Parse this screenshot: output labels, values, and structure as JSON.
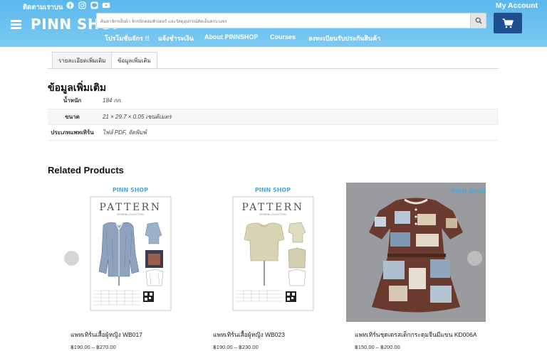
{
  "header": {
    "follow_label": "ติดตามเราบน",
    "account_label": "My Account",
    "logo": "PINN SHOP",
    "search_placeholder": "ค้นหาจักรเย็บผ้า จักรปักคอมพิวเตอร์ และวัสดุอุปกรณ์ตัดเย็บครบวงจร",
    "social_icons": [
      "facebook-icon",
      "instagram-icon",
      "line-icon",
      "youtube-icon"
    ],
    "nav": [
      "โปรโมชั่นจักร !!",
      "แจ้งชำระเงิน",
      "About PINNSHOP",
      "Courses",
      "ลงทะเบียนรับประกันสินค้า"
    ],
    "brand_color": "#5bb8ec",
    "cart_color": "#1e4f90"
  },
  "tabs": [
    "รายละเอียดเพิ่มเติม",
    "ข้อมูลเพิ่มเติม"
  ],
  "active_tab": "ข้อมูลเพิ่มเติม",
  "section_title": "ข้อมูลเพิ่มเติม",
  "attributes": [
    {
      "label": "น้ำหนัก",
      "value": "184 กก."
    },
    {
      "label": "ขนาด",
      "value": "21 × 29.7 × 0.05 เซนติเมตร"
    },
    {
      "label": "ประเภทแพทเทิร์น",
      "value": "ไฟล์ PDF, จัดพิมพ์"
    }
  ],
  "related_title": "Related Products",
  "products": [
    {
      "name": "แพทเทิร์นเสื้อผู้หญิง WB017",
      "price": "฿190.00 – ฿270.00",
      "brand": "PINN SHOP",
      "pattern_title": "PATTERN",
      "pattern_subtitle": "WOMEN COLLECTION"
    },
    {
      "name": "แพทเทิร์นเสื้อผู้หญิง WB023",
      "price": "฿190.00 – ฿230.00",
      "brand": "PINN SHOP",
      "pattern_title": "PATTERN",
      "pattern_subtitle": "WOMEN COLLECTION"
    },
    {
      "name": "แพทเทิร์นชุดเดรสเด็กกระดุมจีนมีแขน KD006A",
      "price": "฿150.00 – ฿200.00",
      "brand": "PINN SHOP"
    }
  ]
}
